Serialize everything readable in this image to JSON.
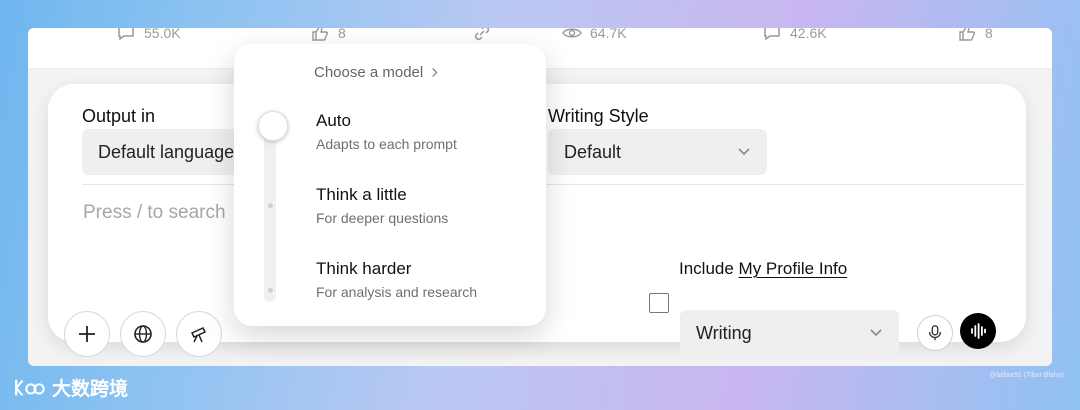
{
  "stats": {
    "left_comments": "55.0K",
    "left_likes": "8",
    "right_views": "64.7K",
    "right_comments": "42.6K",
    "right_likes": "8"
  },
  "output": {
    "label": "Output in",
    "value": "Default language"
  },
  "writing_style": {
    "label": "Writing Style",
    "value": "Default"
  },
  "prompt": {
    "placeholder": "Press / to search"
  },
  "include": {
    "prefix": "Include ",
    "link": "My Profile Info"
  },
  "mode_select": {
    "value": "Writing"
  },
  "model_menu": {
    "heading": "Choose a model",
    "selected": "Auto",
    "options": [
      {
        "title": "Auto",
        "desc": "Adapts to each prompt"
      },
      {
        "title": "Think a little",
        "desc": "For deeper questions"
      },
      {
        "title": "Think harder",
        "desc": "For analysis and research"
      }
    ]
  },
  "watermarks": {
    "brand": "大数跨境",
    "credit": "@btibor91 (Tibor Blaho)"
  },
  "icons": [
    "comment-icon",
    "thumbs-up-icon",
    "link-icon",
    "eye-icon",
    "plus-icon",
    "globe-icon",
    "telescope-icon",
    "chevron-down-icon",
    "chevron-right-icon",
    "mic-icon",
    "voice-wave-icon"
  ]
}
